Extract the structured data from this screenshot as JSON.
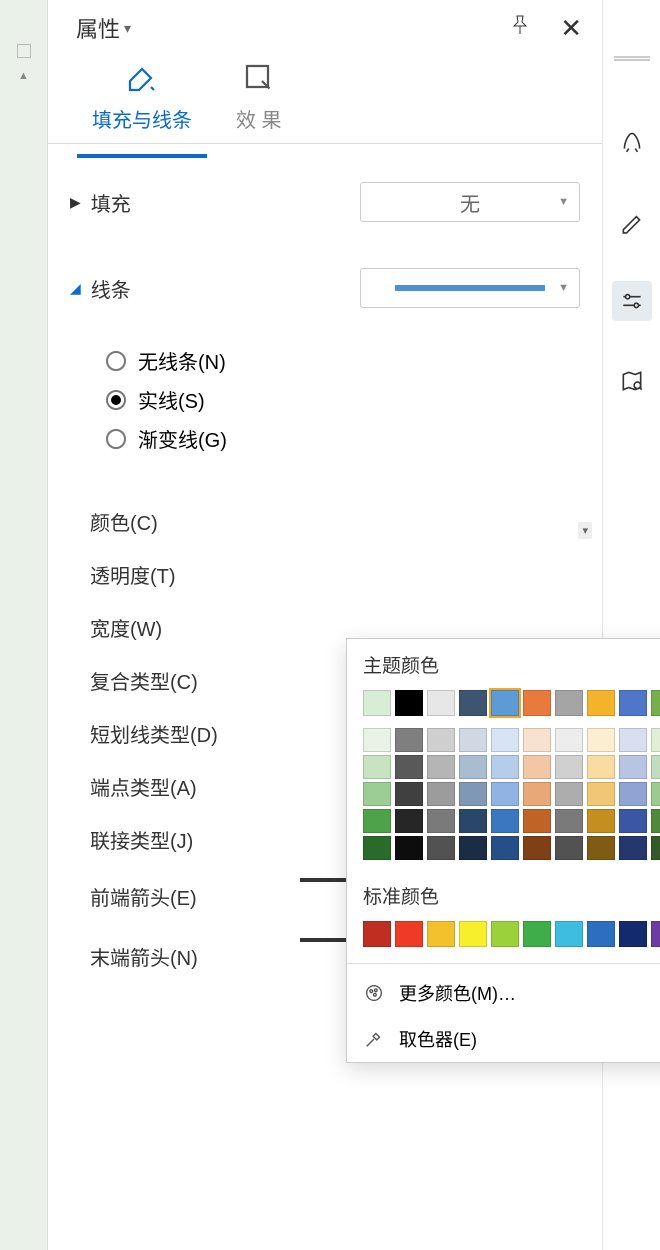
{
  "header": {
    "title": "属性"
  },
  "tabs": {
    "fill_line": "填充与线条",
    "effects": "效 果"
  },
  "fill": {
    "label": "填充",
    "value": "无"
  },
  "line": {
    "label": "线条",
    "options": {
      "none": "无线条(N)",
      "solid": "实线(S)",
      "gradient": "渐变线(G)"
    },
    "selected": "solid"
  },
  "props": {
    "color": "颜色(C)",
    "transparency": "透明度(T)",
    "width": "宽度(W)",
    "compound": "复合类型(C)",
    "dash": "短划线类型(D)",
    "cap": "端点类型(A)",
    "join": "联接类型(J)",
    "begin_arrow": "前端箭头(E)",
    "end_arrow": "末端箭头(N)"
  },
  "popup": {
    "theme_label": "主题颜色",
    "standard_label": "标准颜色",
    "more": "更多颜色(M)…",
    "eyedropper": "取色器(E)",
    "theme_row": [
      "#d8edd6",
      "#000000",
      "#e7e7e7",
      "#3e5571",
      "#5c9bd5",
      "#e87b3b",
      "#a5a5a5",
      "#f3b32b",
      "#4f77c8",
      "#75b04a"
    ],
    "shades": [
      [
        "#e8f3e6",
        "#7f7f7f",
        "#cfcfcf",
        "#cfd8e3",
        "#d7e4f3",
        "#f8e1cf",
        "#ededed",
        "#fceed0",
        "#d7dff0",
        "#e0efd6"
      ],
      [
        "#c7e3c2",
        "#595959",
        "#b5b5b5",
        "#a9bcd0",
        "#b5cceb",
        "#f1c7a6",
        "#d0d0d0",
        "#f8dca2",
        "#b7c5e3",
        "#c0debb"
      ],
      [
        "#9ccd95",
        "#404040",
        "#9c9c9c",
        "#7e98b5",
        "#8fb3e2",
        "#e8a878",
        "#adadad",
        "#f2c774",
        "#8fa4d3",
        "#9cca8f"
      ],
      [
        "#4ea349",
        "#262626",
        "#7a7a7a",
        "#2a4769",
        "#3a77c0",
        "#c06327",
        "#7a7a7a",
        "#c58f1f",
        "#3a57a6",
        "#4f8a3c"
      ],
      [
        "#2a6a2a",
        "#0d0d0d",
        "#525252",
        "#1a2d45",
        "#254f86",
        "#7f3f17",
        "#525252",
        "#7f5b13",
        "#25386e",
        "#335a27"
      ]
    ],
    "standard": [
      "#be2f22",
      "#ef3a26",
      "#f3c12b",
      "#f7ef2b",
      "#9bd23b",
      "#3fae49",
      "#3dbde0",
      "#2c6fc1",
      "#132a6e",
      "#6e3aa3"
    ]
  }
}
